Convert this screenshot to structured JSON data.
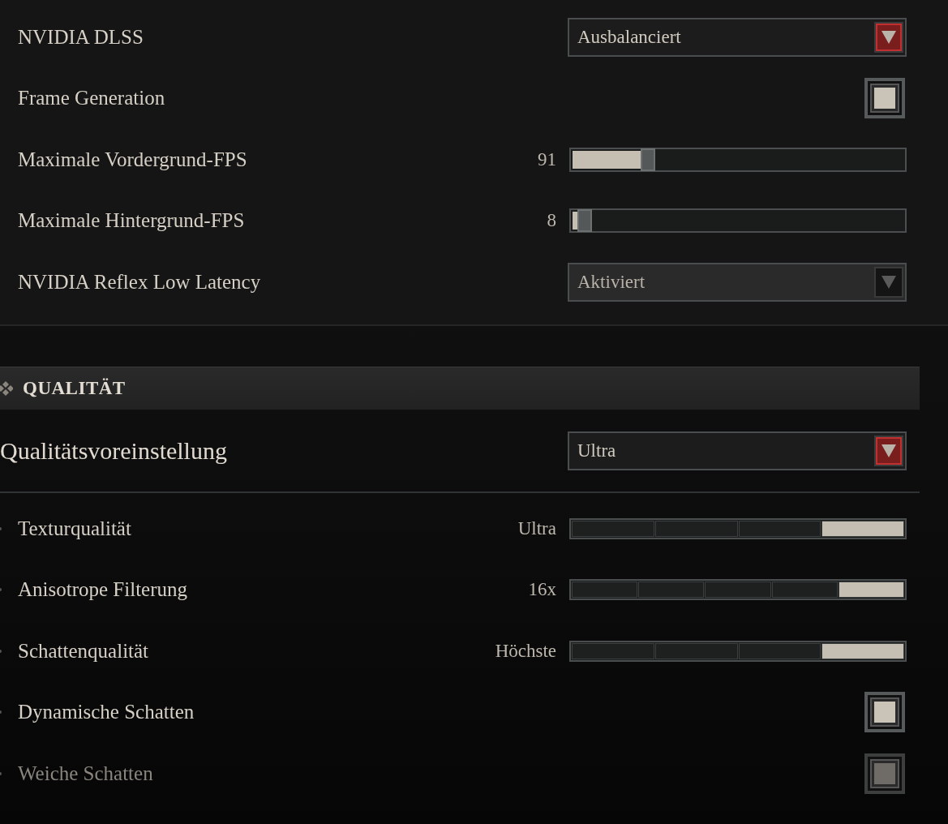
{
  "display_rows": [
    {
      "kind": "dropdown",
      "label": "NVIDIA DLSS",
      "value": "Ausbalanciert",
      "disabled": false
    },
    {
      "kind": "checkbox",
      "label": "Frame Generation",
      "checked": true,
      "disabled": false
    },
    {
      "kind": "slider",
      "label": "Maximale Vordergrund-FPS",
      "reading": "91",
      "level": 0.21
    },
    {
      "kind": "slider",
      "label": "Maximale Hintergrund-FPS",
      "reading": "8",
      "level": 0.02
    },
    {
      "kind": "dropdown",
      "label": "NVIDIA Reflex Low Latency",
      "value": "Aktiviert",
      "disabled": true
    }
  ],
  "quality_section": {
    "title": "QUALITÄT",
    "preset": {
      "label": "Qualitätsvoreinstellung",
      "value": "Ultra",
      "disabled": false
    },
    "rows": [
      {
        "kind": "steps",
        "label": "Texturqualität",
        "reading": "Ultra",
        "steps": [
          {
            "selected": false
          },
          {
            "selected": false
          },
          {
            "selected": false
          },
          {
            "selected": true
          }
        ]
      },
      {
        "kind": "steps",
        "label": "Anisotrope Filterung",
        "reading": "16x",
        "steps": [
          {
            "selected": false
          },
          {
            "selected": false
          },
          {
            "selected": false
          },
          {
            "selected": false
          },
          {
            "selected": true
          }
        ]
      },
      {
        "kind": "steps",
        "label": "Schattenqualität",
        "reading": "Höchste",
        "steps": [
          {
            "selected": false
          },
          {
            "selected": false
          },
          {
            "selected": false
          },
          {
            "selected": true
          }
        ]
      },
      {
        "kind": "checkbox",
        "label": "Dynamische Schatten",
        "checked": true,
        "disabled": false
      },
      {
        "kind": "checkbox",
        "label": "Weiche Schatten",
        "checked": true,
        "disabled": true
      }
    ]
  }
}
